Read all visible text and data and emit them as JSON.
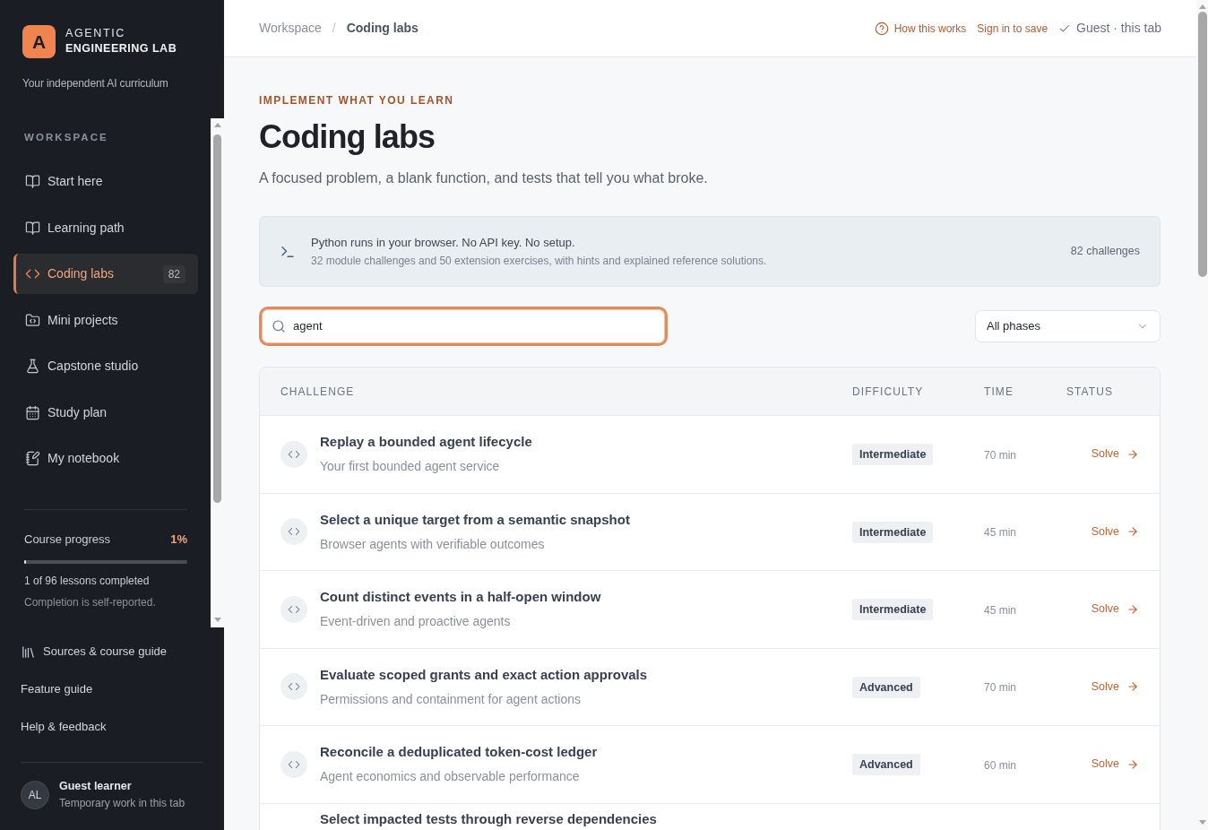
{
  "sidebar": {
    "brand": {
      "logo_letter": "A",
      "name_line_1": "AGENTIC",
      "name_line_2": "ENGINEERING LAB",
      "tagline": "Your independent AI curriculum"
    },
    "section_label": "WORKSPACE",
    "items": [
      {
        "label": "Start here",
        "selected": false
      },
      {
        "label": "Learning path",
        "selected": false
      },
      {
        "label": "Coding labs",
        "selected": true,
        "badge": "82"
      },
      {
        "label": "Mini projects",
        "selected": false
      },
      {
        "label": "Capstone studio",
        "selected": false
      },
      {
        "label": "Study plan",
        "selected": false
      },
      {
        "label": "My notebook",
        "selected": false
      }
    ],
    "progress": {
      "label": "Course progress",
      "percent": "1%",
      "level": 0.01,
      "summary": "1 of 96 lessons completed",
      "note": "Completion is self-reported."
    },
    "links": [
      "Sources & course guide",
      "Feature guide",
      "Help & feedback"
    ],
    "user": {
      "initials": "AL",
      "name": "Guest learner",
      "note": "Temporary work in this tab"
    }
  },
  "header": {
    "breadcrumb": [
      {
        "label": "Workspace",
        "current": false
      },
      {
        "label": "Coding labs",
        "current": true
      }
    ],
    "separator": "/",
    "actions": [
      {
        "kind": "help",
        "label": "How this works"
      },
      {
        "kind": "link",
        "label": "Sign in to save"
      },
      {
        "kind": "status",
        "label": "Guest · this tab"
      }
    ]
  },
  "page": {
    "eyebrow": "IMPLEMENT WHAT YOU LEARN",
    "title": "Coding labs",
    "description": "A focused problem, a blank function, and tests that tell you what broke."
  },
  "info_banner": {
    "title": "Python runs in your browser. No API key. No setup.",
    "detail": "32 module challenges and 50 extension exercises, with hints and explained reference solutions.",
    "count": "82 challenges"
  },
  "search": {
    "value": "agent",
    "focused": true
  },
  "phase_filter": {
    "value": "All phases"
  },
  "table": {
    "columns": [
      "CHALLENGE",
      "DIFFICULTY",
      "TIME",
      "STATUS"
    ],
    "rows": [
      {
        "title": "Replay a bounded agent lifecycle",
        "subtitle": "Your first bounded agent service",
        "difficulty": "Intermediate",
        "time": "70 min",
        "action": "Solve"
      },
      {
        "title": "Select a unique target from a semantic snapshot",
        "subtitle": "Browser agents with verifiable outcomes",
        "difficulty": "Intermediate",
        "time": "45 min",
        "action": "Solve"
      },
      {
        "title": "Count distinct events in a half-open window",
        "subtitle": "Event-driven and proactive agents",
        "difficulty": "Intermediate",
        "time": "45 min",
        "action": "Solve"
      },
      {
        "title": "Evaluate scoped grants and exact action approvals",
        "subtitle": "Permissions and containment for agent actions",
        "difficulty": "Advanced",
        "time": "70 min",
        "action": "Solve"
      },
      {
        "title": "Reconcile a deduplicated token-cost ledger",
        "subtitle": "Agent economics and observable performance",
        "difficulty": "Advanced",
        "time": "60 min",
        "action": "Solve"
      },
      {
        "title": "Select impacted tests through reverse dependencies"
      }
    ]
  }
}
